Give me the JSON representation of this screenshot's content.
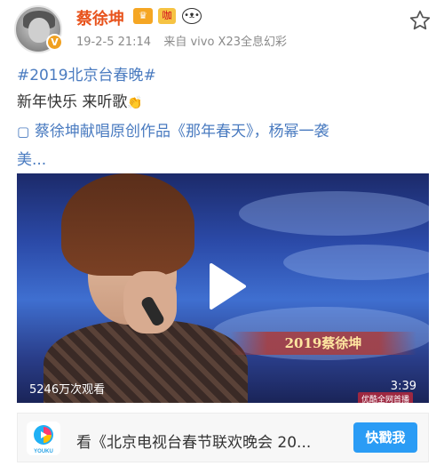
{
  "post": {
    "username": "蔡徐坤",
    "badges": {
      "vip": "♛",
      "shine": "咖",
      "panda": "•ᴥ•"
    },
    "verified_mark": "V",
    "time": "19-2-5 21:14",
    "source": "来自 vivo X23全息幻彩",
    "hashtag": "#2019北京台春晚#",
    "line1": "新年快乐 来听歌",
    "line1_emoji": "👏",
    "line2_icon": "▢",
    "line2": "蔡徐坤献唱原创作品《那年春天》，杨幂一袭",
    "line3": "美..."
  },
  "video": {
    "caption": "2019蔡徐坤",
    "views": "5246万次观看",
    "duration": "3:39",
    "source_tag": "优酷全网首播"
  },
  "promo": {
    "text": "看《北京电视台春节联欢晚会 20...",
    "button": "快戳我",
    "logo_text": "YOUKU"
  },
  "colors": {
    "username": "#e8541e",
    "link": "#4a7bc0",
    "button": "#2a9cf5"
  },
  "icons": {
    "star": "star-icon",
    "play": "play-icon",
    "youku": "youku-logo-icon"
  }
}
